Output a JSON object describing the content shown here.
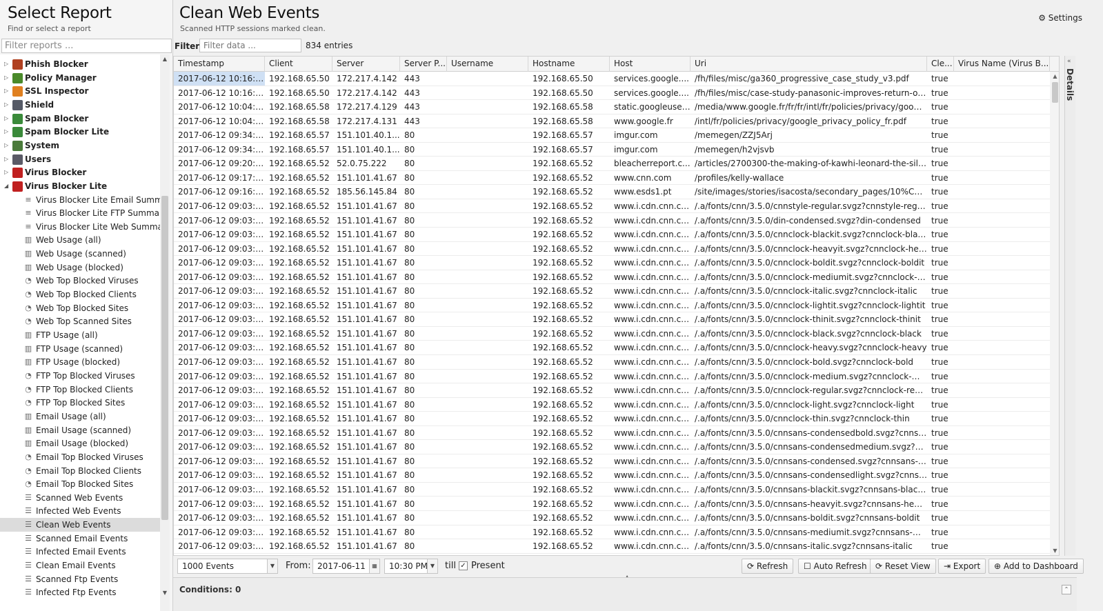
{
  "left": {
    "title": "Select Report",
    "subtitle": "Find or select a report",
    "filter_placeholder": "Filter reports ...",
    "parents": [
      {
        "label": "Phish Blocker",
        "expanded": false,
        "color": "#b04020"
      },
      {
        "label": "Policy Manager",
        "expanded": false,
        "color": "#4a8a2a"
      },
      {
        "label": "SSL Inspector",
        "expanded": false,
        "color": "#e08020"
      },
      {
        "label": "Shield",
        "expanded": false,
        "color": "#555a66"
      },
      {
        "label": "Spam Blocker",
        "expanded": false,
        "color": "#3a8a3a"
      },
      {
        "label": "Spam Blocker Lite",
        "expanded": false,
        "color": "#3a8a3a"
      },
      {
        "label": "System",
        "expanded": false,
        "color": "#4a7a3a"
      },
      {
        "label": "Users",
        "expanded": false,
        "color": "#5a5a66"
      },
      {
        "label": "Virus Blocker",
        "expanded": false,
        "color": "#c02020"
      },
      {
        "label": "Virus Blocker Lite",
        "expanded": true,
        "color": "#c02020"
      }
    ],
    "children": [
      {
        "label": "Virus Blocker Lite Email Summary",
        "icon": "list"
      },
      {
        "label": "Virus Blocker Lite FTP Summary",
        "icon": "list"
      },
      {
        "label": "Virus Blocker Lite Web Summary",
        "icon": "list"
      },
      {
        "label": "Web Usage (all)",
        "icon": "bar"
      },
      {
        "label": "Web Usage (scanned)",
        "icon": "bar"
      },
      {
        "label": "Web Usage (blocked)",
        "icon": "bar"
      },
      {
        "label": "Web Top Blocked Viruses",
        "icon": "pie"
      },
      {
        "label": "Web Top Blocked Clients",
        "icon": "pie"
      },
      {
        "label": "Web Top Blocked Sites",
        "icon": "pie"
      },
      {
        "label": "Web Top Scanned Sites",
        "icon": "pie"
      },
      {
        "label": "FTP Usage (all)",
        "icon": "bar"
      },
      {
        "label": "FTP Usage (scanned)",
        "icon": "bar"
      },
      {
        "label": "FTP Usage (blocked)",
        "icon": "bar"
      },
      {
        "label": "FTP Top Blocked Viruses",
        "icon": "pie"
      },
      {
        "label": "FTP Top Blocked Clients",
        "icon": "pie"
      },
      {
        "label": "FTP Top Blocked Sites",
        "icon": "pie"
      },
      {
        "label": "Email Usage (all)",
        "icon": "bar"
      },
      {
        "label": "Email Usage (scanned)",
        "icon": "bar"
      },
      {
        "label": "Email Usage (blocked)",
        "icon": "bar"
      },
      {
        "label": "Email Top Blocked Viruses",
        "icon": "pie"
      },
      {
        "label": "Email Top Blocked Clients",
        "icon": "pie"
      },
      {
        "label": "Email Top Blocked Sites",
        "icon": "pie"
      },
      {
        "label": "Scanned Web Events",
        "icon": "events"
      },
      {
        "label": "Infected Web Events",
        "icon": "events"
      },
      {
        "label": "Clean Web Events",
        "icon": "events",
        "selected": true
      },
      {
        "label": "Scanned Email Events",
        "icon": "events"
      },
      {
        "label": "Infected Email Events",
        "icon": "events"
      },
      {
        "label": "Clean Email Events",
        "icon": "events"
      },
      {
        "label": "Scanned Ftp Events",
        "icon": "events"
      },
      {
        "label": "Infected Ftp Events",
        "icon": "events"
      }
    ]
  },
  "right": {
    "title": "Clean Web Events",
    "subtitle": "Scanned HTTP sessions marked clean.",
    "settings_label": "Settings",
    "filter_label": "Filter:",
    "filter_placeholder": "Filter data ...",
    "entries": "834 entries",
    "details_label": "Details"
  },
  "columns": [
    "Timestamp",
    "Client",
    "Server",
    "Server P...",
    "Username",
    "Hostname",
    "Host",
    "Uri",
    "Cle...",
    "Virus Name (Virus B..."
  ],
  "rows": [
    [
      "2017-06-12 10:16:3...",
      "192.168.65.50",
      "172.217.4.142",
      "443",
      "",
      "192.168.65.50",
      "services.google....",
      "/fh/files/misc/ga360_progressive_case_study_v3.pdf",
      "true",
      ""
    ],
    [
      "2017-06-12 10:16:3...",
      "192.168.65.50",
      "172.217.4.142",
      "443",
      "",
      "192.168.65.50",
      "services.google....",
      "/fh/files/misc/case-study-panasonic-improves-return-on-a...",
      "true",
      ""
    ],
    [
      "2017-06-12 10:04:2...",
      "192.168.65.58",
      "172.217.4.129",
      "443",
      "",
      "192.168.65.58",
      "static.googleuser...",
      "/media/www.google.fr/fr/fr/intl/fr/policies/privacy/google_p...",
      "true",
      ""
    ],
    [
      "2017-06-12 10:04:2...",
      "192.168.65.58",
      "172.217.4.131",
      "443",
      "",
      "192.168.65.58",
      "www.google.fr",
      "/intl/fr/policies/privacy/google_privacy_policy_fr.pdf",
      "true",
      ""
    ],
    [
      "2017-06-12 09:34:2...",
      "192.168.65.57",
      "151.101.40.1...",
      "80",
      "",
      "192.168.65.57",
      "imgur.com",
      "/memegen/ZZJ5Arj",
      "true",
      ""
    ],
    [
      "2017-06-12 09:34:2...",
      "192.168.65.57",
      "151.101.40.1...",
      "80",
      "",
      "192.168.65.57",
      "imgur.com",
      "/memegen/h2vjsvb",
      "true",
      ""
    ],
    [
      "2017-06-12 09:20:1...",
      "192.168.65.52",
      "52.0.75.222",
      "80",
      "",
      "192.168.65.52",
      "bleacherreport.c...",
      "/articles/2700300-the-making-of-kawhi-leonard-the-silent-...",
      "true",
      ""
    ],
    [
      "2017-06-12 09:17:5...",
      "192.168.65.52",
      "151.101.41.67",
      "80",
      "",
      "192.168.65.52",
      "www.cnn.com",
      "/profiles/kelly-wallace",
      "true",
      ""
    ],
    [
      "2017-06-12 09:16:4...",
      "192.168.65.52",
      "185.56.145.84",
      "80",
      "",
      "192.168.65.52",
      "www.esds1.pt",
      "/site/images/stories/isacosta/secondary_pages/10%C2%...",
      "true",
      ""
    ],
    [
      "2017-06-12 09:03:0...",
      "192.168.65.52",
      "151.101.41.67",
      "80",
      "",
      "192.168.65.52",
      "www.i.cdn.cnn.co...",
      "/.a/fonts/cnn/3.5.0/cnnstyle-regular.svgz?cnnstyle-regular",
      "true",
      ""
    ],
    [
      "2017-06-12 09:03:0...",
      "192.168.65.52",
      "151.101.41.67",
      "80",
      "",
      "192.168.65.52",
      "www.i.cdn.cnn.co...",
      "/.a/fonts/cnn/3.5.0/din-condensed.svgz?din-condensed",
      "true",
      ""
    ],
    [
      "2017-06-12 09:03:0...",
      "192.168.65.52",
      "151.101.41.67",
      "80",
      "",
      "192.168.65.52",
      "www.i.cdn.cnn.co...",
      "/.a/fonts/cnn/3.5.0/cnnclock-blackit.svgz?cnnclock-blackit",
      "true",
      ""
    ],
    [
      "2017-06-12 09:03:0...",
      "192.168.65.52",
      "151.101.41.67",
      "80",
      "",
      "192.168.65.52",
      "www.i.cdn.cnn.co...",
      "/.a/fonts/cnn/3.5.0/cnnclock-heavyit.svgz?cnnclock-heavyit",
      "true",
      ""
    ],
    [
      "2017-06-12 09:03:0...",
      "192.168.65.52",
      "151.101.41.67",
      "80",
      "",
      "192.168.65.52",
      "www.i.cdn.cnn.co...",
      "/.a/fonts/cnn/3.5.0/cnnclock-boldit.svgz?cnnclock-boldit",
      "true",
      ""
    ],
    [
      "2017-06-12 09:03:0...",
      "192.168.65.52",
      "151.101.41.67",
      "80",
      "",
      "192.168.65.52",
      "www.i.cdn.cnn.co...",
      "/.a/fonts/cnn/3.5.0/cnnclock-mediumit.svgz?cnnclock-med...",
      "true",
      ""
    ],
    [
      "2017-06-12 09:03:0...",
      "192.168.65.52",
      "151.101.41.67",
      "80",
      "",
      "192.168.65.52",
      "www.i.cdn.cnn.co...",
      "/.a/fonts/cnn/3.5.0/cnnclock-italic.svgz?cnnclock-italic",
      "true",
      ""
    ],
    [
      "2017-06-12 09:03:0...",
      "192.168.65.52",
      "151.101.41.67",
      "80",
      "",
      "192.168.65.52",
      "www.i.cdn.cnn.co...",
      "/.a/fonts/cnn/3.5.0/cnnclock-lightit.svgz?cnnclock-lightit",
      "true",
      ""
    ],
    [
      "2017-06-12 09:03:0...",
      "192.168.65.52",
      "151.101.41.67",
      "80",
      "",
      "192.168.65.52",
      "www.i.cdn.cnn.co...",
      "/.a/fonts/cnn/3.5.0/cnnclock-thinit.svgz?cnnclock-thinit",
      "true",
      ""
    ],
    [
      "2017-06-12 09:03:0...",
      "192.168.65.52",
      "151.101.41.67",
      "80",
      "",
      "192.168.65.52",
      "www.i.cdn.cnn.co...",
      "/.a/fonts/cnn/3.5.0/cnnclock-black.svgz?cnnclock-black",
      "true",
      ""
    ],
    [
      "2017-06-12 09:03:0...",
      "192.168.65.52",
      "151.101.41.67",
      "80",
      "",
      "192.168.65.52",
      "www.i.cdn.cnn.co...",
      "/.a/fonts/cnn/3.5.0/cnnclock-heavy.svgz?cnnclock-heavy",
      "true",
      ""
    ],
    [
      "2017-06-12 09:03:0...",
      "192.168.65.52",
      "151.101.41.67",
      "80",
      "",
      "192.168.65.52",
      "www.i.cdn.cnn.co...",
      "/.a/fonts/cnn/3.5.0/cnnclock-bold.svgz?cnnclock-bold",
      "true",
      ""
    ],
    [
      "2017-06-12 09:03:0...",
      "192.168.65.52",
      "151.101.41.67",
      "80",
      "",
      "192.168.65.52",
      "www.i.cdn.cnn.co...",
      "/.a/fonts/cnn/3.5.0/cnnclock-medium.svgz?cnnclock-mediu...",
      "true",
      ""
    ],
    [
      "2017-06-12 09:03:0...",
      "192.168.65.52",
      "151.101.41.67",
      "80",
      "",
      "192.168.65.52",
      "www.i.cdn.cnn.co...",
      "/.a/fonts/cnn/3.5.0/cnnclock-regular.svgz?cnnclock-regular",
      "true",
      ""
    ],
    [
      "2017-06-12 09:03:0...",
      "192.168.65.52",
      "151.101.41.67",
      "80",
      "",
      "192.168.65.52",
      "www.i.cdn.cnn.co...",
      "/.a/fonts/cnn/3.5.0/cnnclock-light.svgz?cnnclock-light",
      "true",
      ""
    ],
    [
      "2017-06-12 09:03:0...",
      "192.168.65.52",
      "151.101.41.67",
      "80",
      "",
      "192.168.65.52",
      "www.i.cdn.cnn.co...",
      "/.a/fonts/cnn/3.5.0/cnnclock-thin.svgz?cnnclock-thin",
      "true",
      ""
    ],
    [
      "2017-06-12 09:03:0...",
      "192.168.65.52",
      "151.101.41.67",
      "80",
      "",
      "192.168.65.52",
      "www.i.cdn.cnn.co...",
      "/.a/fonts/cnn/3.5.0/cnnsans-condensedbold.svgz?cnnsans...",
      "true",
      ""
    ],
    [
      "2017-06-12 09:03:0...",
      "192.168.65.52",
      "151.101.41.67",
      "80",
      "",
      "192.168.65.52",
      "www.i.cdn.cnn.co...",
      "/.a/fonts/cnn/3.5.0/cnnsans-condensedmedium.svgz?cnn...",
      "true",
      ""
    ],
    [
      "2017-06-12 09:03:0...",
      "192.168.65.52",
      "151.101.41.67",
      "80",
      "",
      "192.168.65.52",
      "www.i.cdn.cnn.co...",
      "/.a/fonts/cnn/3.5.0/cnnsans-condensed.svgz?cnnsans-con...",
      "true",
      ""
    ],
    [
      "2017-06-12 09:03:0...",
      "192.168.65.52",
      "151.101.41.67",
      "80",
      "",
      "192.168.65.52",
      "www.i.cdn.cnn.co...",
      "/.a/fonts/cnn/3.5.0/cnnsans-condensedlight.svgz?cnnsans...",
      "true",
      ""
    ],
    [
      "2017-06-12 09:03:0...",
      "192.168.65.52",
      "151.101.41.67",
      "80",
      "",
      "192.168.65.52",
      "www.i.cdn.cnn.co...",
      "/.a/fonts/cnn/3.5.0/cnnsans-blackit.svgz?cnnsans-blackit",
      "true",
      ""
    ],
    [
      "2017-06-12 09:03:0...",
      "192.168.65.52",
      "151.101.41.67",
      "80",
      "",
      "192.168.65.52",
      "www.i.cdn.cnn.co...",
      "/.a/fonts/cnn/3.5.0/cnnsans-heavyit.svgz?cnnsans-heavyit",
      "true",
      ""
    ],
    [
      "2017-06-12 09:03:0...",
      "192.168.65.52",
      "151.101.41.67",
      "80",
      "",
      "192.168.65.52",
      "www.i.cdn.cnn.co...",
      "/.a/fonts/cnn/3.5.0/cnnsans-boldit.svgz?cnnsans-boldit",
      "true",
      ""
    ],
    [
      "2017-06-12 09:03:0...",
      "192.168.65.52",
      "151.101.41.67",
      "80",
      "",
      "192.168.65.52",
      "www.i.cdn.cnn.co...",
      "/.a/fonts/cnn/3.5.0/cnnsans-mediumit.svgz?cnnsans-med...",
      "true",
      ""
    ],
    [
      "2017-06-12 09:03:0...",
      "192.168.65.52",
      "151.101.41.67",
      "80",
      "",
      "192.168.65.52",
      "www.i.cdn.cnn.co...",
      "/.a/fonts/cnn/3.5.0/cnnsans-italic.svgz?cnnsans-italic",
      "true",
      ""
    ]
  ],
  "toolbar": {
    "events_select": "1000 Events",
    "from_label": "From:",
    "from_date": "2017-06-11",
    "from_time": "10:30 PM",
    "till_label": "till",
    "present_label": "Present",
    "present_checked": true,
    "refresh": "Refresh",
    "auto_refresh": "Auto Refresh",
    "reset_view": "Reset View",
    "export": "Export",
    "add_dashboard": "Add to Dashboard"
  },
  "conditions_label": "Conditions: 0"
}
